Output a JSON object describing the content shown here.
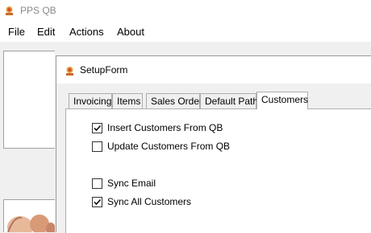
{
  "app": {
    "title": "PPS QB",
    "menu": [
      "File",
      "Edit",
      "Actions",
      "About"
    ]
  },
  "dialog": {
    "title": "SetupForm",
    "tabs": [
      "Invoicing",
      "Items",
      "Sales Order",
      "Default Path",
      "Customers"
    ],
    "active_tab": "Customers",
    "options": [
      {
        "label": "Insert Customers From QB",
        "checked": true
      },
      {
        "label": "Update Customers From QB",
        "checked": false
      },
      {
        "label": "Sync Email",
        "checked": false
      },
      {
        "label": "Sync All Customers",
        "checked": true
      }
    ]
  }
}
